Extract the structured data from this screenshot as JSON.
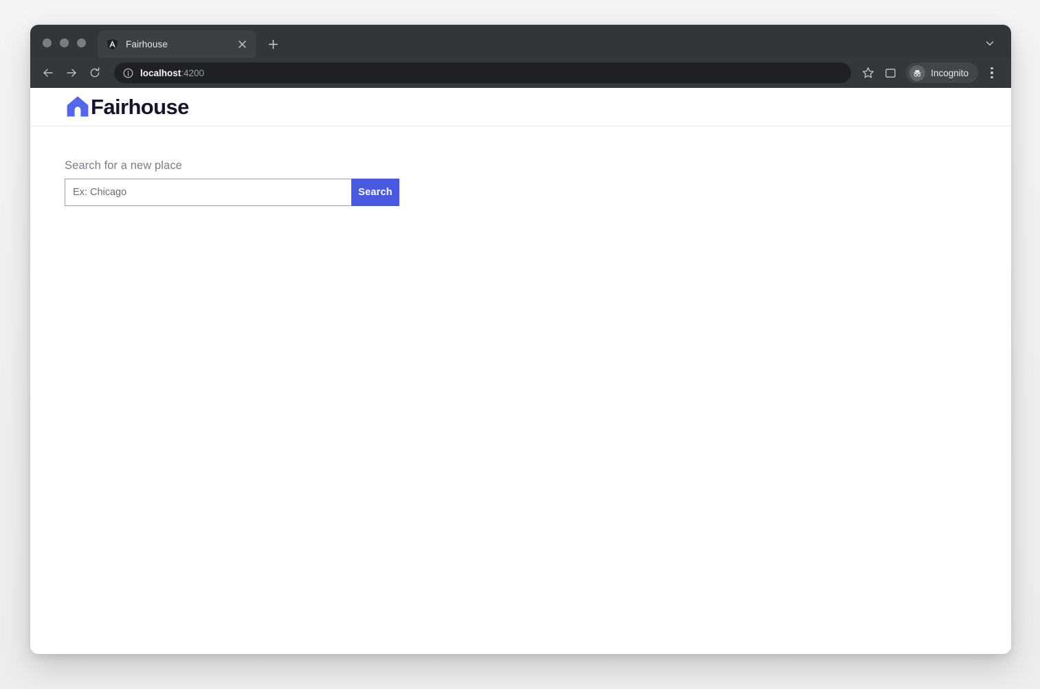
{
  "browser": {
    "tab": {
      "title": "Fairhouse",
      "favicon": "angular-logo-icon",
      "close_label": "×"
    },
    "new_tab_label": "+",
    "tab_search_icon": "chevron-down-icon",
    "nav": {
      "back_icon": "arrow-left-icon",
      "forward_icon": "arrow-right-icon",
      "reload_icon": "reload-icon"
    },
    "omnibox": {
      "info_icon": "info-circle-icon",
      "host": "localhost",
      "port": ":4200",
      "full_url": "localhost:4200"
    },
    "actions": {
      "bookmark_icon": "star-icon",
      "side_panel_icon": "side-panel-icon",
      "profile_icon": "incognito-icon",
      "profile_label": "Incognito",
      "menu_icon": "three-dots-menu-icon"
    }
  },
  "app": {
    "brand": {
      "mark": "house-icon",
      "name": "Fairhouse",
      "accent_color": "#5566e8"
    },
    "search": {
      "label": "Search for a new place",
      "placeholder": "Ex: Chicago",
      "value": "",
      "button_label": "Search",
      "button_color": "#4a5ae0"
    }
  }
}
